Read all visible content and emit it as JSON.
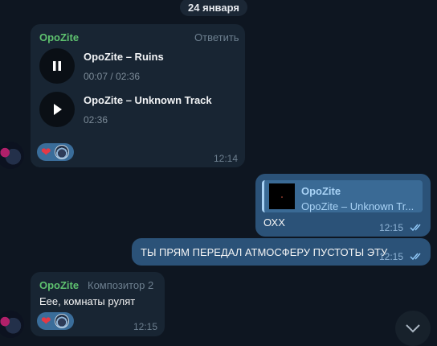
{
  "date_separator": "24 января",
  "messages": [
    {
      "sender": "OpoZite",
      "reply_label": "Ответить",
      "tracks": [
        {
          "title": "OpoZite – Ruins",
          "time": "00:07 / 02:36",
          "state": "pause-icon"
        },
        {
          "title": "OpoZite – Unknown Track",
          "time": "02:36",
          "state": "play-icon"
        }
      ],
      "reactions": [
        "heart",
        "user-avatar"
      ],
      "time": "12:14"
    },
    {
      "outgoing": true,
      "quote": {
        "title": "OpoZite",
        "subtitle": "OpoZite – Unknown Tr..."
      },
      "text": "ОХХ",
      "time": "12:15",
      "status": "read"
    },
    {
      "outgoing": true,
      "text": "ТЫ ПРЯМ ПЕРЕДАЛ АТМОСФЕРУ ПУСТОТЫ ЭТУ",
      "time": "12:15",
      "status": "read"
    },
    {
      "sender": "OpoZite",
      "role": "Композитор 2",
      "text": "Еее, комнаты рулят",
      "reactions": [
        "heart",
        "user-avatar"
      ],
      "time": "12:15"
    }
  ],
  "colors": {
    "background": "#0e1621",
    "incoming_bubble": "#182533",
    "outgoing_bubble": "#2b5278",
    "sender_name": "#5ec16f",
    "accent": "#a8d2f5"
  }
}
